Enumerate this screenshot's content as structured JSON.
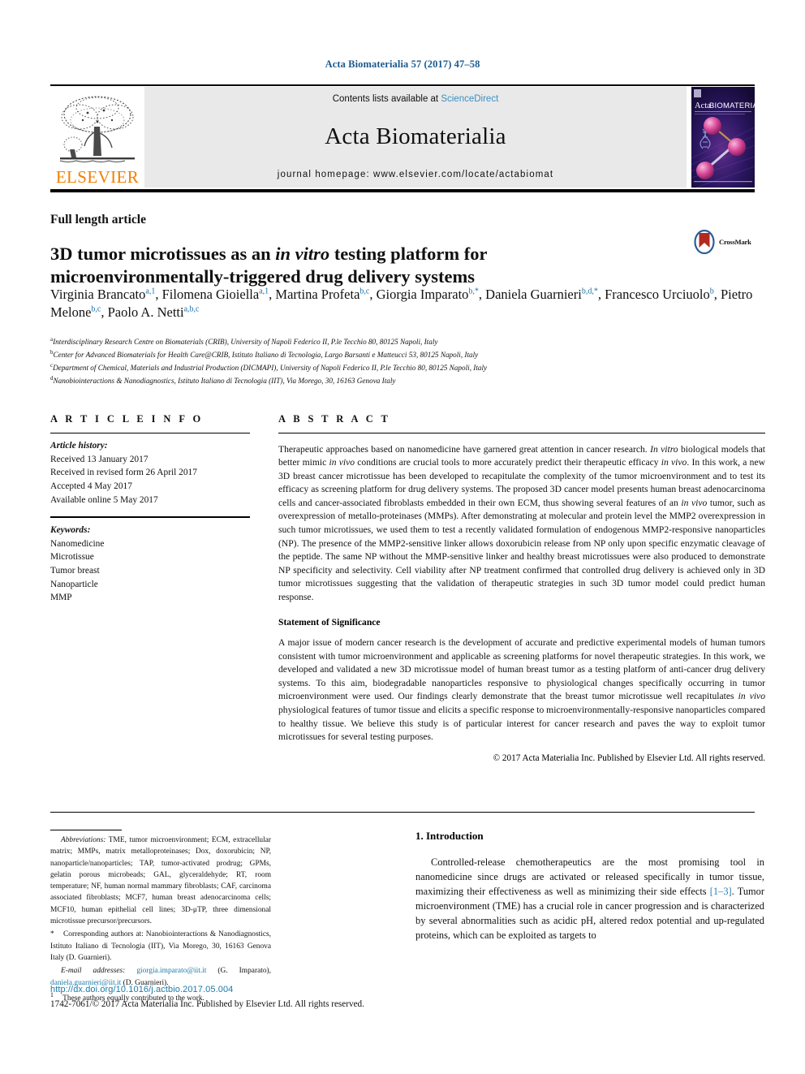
{
  "running_head": "Acta Biomaterialia 57 (2017) 47–58",
  "masthead": {
    "contents_prefix": "Contents lists available at ",
    "sciencedirect": "ScienceDirect",
    "journal_title": "Acta Biomaterialia",
    "homepage": "journal homepage: www.elsevier.com/locate/actabiomat",
    "publisher_word": "ELSEVIER",
    "cover_title": "Acta BIOMATERIALIA",
    "accent_orange": "#f08000",
    "link_blue": "#3a8fc4",
    "band_gray": "#e9e9e9"
  },
  "article": {
    "type": "Full length article",
    "title_line1": "3D tumor microtissues as an ",
    "title_italic": "in vitro",
    "title_line1b": " testing platform for",
    "title_line2": "microenvironmentally-triggered drug delivery systems",
    "crossmark_label": "CrossMark",
    "authors": [
      {
        "name": "Virginia Brancato",
        "sup": "a,1",
        "sep": ", "
      },
      {
        "name": "Filomena Gioiella",
        "sup": "a,1",
        "sep": ", "
      },
      {
        "name": "Martina Profeta",
        "sup": "b,c",
        "sep": ", "
      },
      {
        "name": "Giorgia Imparato",
        "sup": "b,*",
        "sep": ", "
      },
      {
        "name": "Daniela Guarnieri",
        "sup": "b,d,*",
        "sep": ", "
      },
      {
        "name": "Francesco Urciuolo",
        "sup": "b",
        "sep": ", "
      },
      {
        "name": "Pietro Melone",
        "sup": "b,c",
        "sep": ", "
      },
      {
        "name": "Paolo A. Netti",
        "sup": "a,b,c",
        "sep": ""
      }
    ],
    "affiliations": [
      {
        "key": "a",
        "text": "Interdisciplinary Research Centre on Biomaterials (CRIB), University of Napoli Federico II, P.le Tecchio 80, 80125 Napoli, Italy"
      },
      {
        "key": "b",
        "text": "Center for Advanced Biomaterials for Health Care@CRIB, Istituto Italiano di Tecnologia, Largo Barsanti e Matteucci 53, 80125 Napoli, Italy"
      },
      {
        "key": "c",
        "text": "Department of Chemical, Materials and Industrial Production (DICMAPI), University of Napoli Federico II, P.le Tecchio 80, 80125 Napoli, Italy"
      },
      {
        "key": "d",
        "text": "Nanobiointeractions & Nanodiagnostics, Istituto Italiano di Tecnologia (IIT), Via Morego, 30, 16163 Genova Italy"
      }
    ]
  },
  "article_info": {
    "heading": "A R T I C L E   I N F O",
    "history_label": "Article history:",
    "history": [
      "Received 13 January 2017",
      "Received in revised form 26 April 2017",
      "Accepted 4 May 2017",
      "Available online 5 May 2017"
    ],
    "keywords_label": "Keywords:",
    "keywords": [
      "Nanomedicine",
      "Microtissue",
      "Tumor breast",
      "Nanoparticle",
      "MMP"
    ]
  },
  "abstract": {
    "heading": "A B S T R A C T",
    "p1_a": "Therapeutic approaches based on nanomedicine have garnered great attention in cancer research. ",
    "p1_i1": "In vitro",
    "p1_b": " biological models that better mimic ",
    "p1_i2": "in vivo",
    "p1_c": " conditions are crucial tools to more accurately predict their therapeutic efficacy ",
    "p1_i3": "in vivo",
    "p1_d": ". In this work, a new 3D breast cancer microtissue has been developed to recapitulate the complexity of the tumor microenvironment and to test its efficacy as screening platform for drug delivery systems. The proposed 3D cancer model presents human breast adenocarcinoma cells and cancer-associated fibroblasts embedded in their own ECM, thus showing several features of an ",
    "p1_i4": "in vivo",
    "p1_e": " tumor, such as overexpression of metallo-proteinases (MMPs). After demonstrating at molecular and protein level the MMP2 overexpression in such tumor microtissues, we used them to test a recently validated formulation of endogenous MMP2-responsive nanoparticles (NP). The presence of the MMP2-sensitive linker allows doxorubicin release from NP only upon specific enzymatic cleavage of the peptide. The same NP without the MMP-sensitive linker and healthy breast microtissues were also produced to demonstrate NP specificity and selectivity. Cell viability after NP treatment confirmed that controlled drug delivery is achieved only in 3D tumor microtissues suggesting that the validation of therapeutic strategies in such 3D tumor model could predict human response.",
    "sos_heading": "Statement of Significance",
    "sos_a": "A major issue of modern cancer research is the development of accurate and predictive experimental models of human tumors consistent with tumor microenvironment and applicable as screening platforms for novel therapeutic strategies. In this work, we developed and validated a new 3D microtissue model of human breast tumor as a testing platform of anti-cancer drug delivery systems. To this aim, biodegradable nanoparticles responsive to physiological changes specifically occurring in tumor microenvironment were used. Our findings clearly demonstrate that the breast tumor microtissue well recapitulates ",
    "sos_i1": "in vivo",
    "sos_b": " physiological features of tumor tissue and elicits a specific response to microenvironmentally-responsive nanoparticles compared to healthy tissue. We believe this study is of particular interest for cancer research and paves the way to exploit tumor microtissues for several testing purposes.",
    "copyright": "© 2017 Acta Materialia Inc. Published by Elsevier Ltd. All rights reserved."
  },
  "footnotes": {
    "abbrev_label": "Abbreviations:",
    "abbrev_text": " TME, tumor microenvironment; ECM, extracellular matrix; MMPs, matrix metalloproteinases; Dox, doxorubicin; NP, nanoparticle/nanoparticles; TAP, tumor-activated prodrug; GPMs, gelatin porous microbeads; GAL, glyceraldehyde; RT, room temperature; NF, human normal mammary fibroblasts; CAF, carcinoma associated fibroblasts; MCF7, human breast adenocarcinoma cells; MCF10, human epithelial cell lines; 3D-μTP, three dimensional microtissue precursor/precursors.",
    "corresponding_marker": "*",
    "corresponding_text": " Corresponding authors at: Nanobiointeractions & Nanodiagnostics, Istituto Italiano di Tecnologia (IIT), Via Morego, 30, 16163 Genova Italy (D. Guarnieri).",
    "email_label": "E-mail addresses:",
    "email1": "giorgia.imparato@iit.it",
    "email1_owner": " (G. Imparato), ",
    "email2": "daniela.guarnieri@iit.it",
    "email2_owner": " (D. Guarnieri).",
    "equal_marker": "1",
    "equal_text": " These authors equally contributed to the work."
  },
  "introduction": {
    "heading": "1. Introduction",
    "p1_a": "Controlled-release chemotherapeutics are the most promising tool in nanomedicine since drugs are activated or released specifically in tumor tissue, maximizing their effectiveness as well as minimizing their side effects ",
    "p1_ref": "[1–3]",
    "p1_b": ". Tumor microenvironment (TME) has a crucial role in cancer progression and is characterized by several abnormalities such as acidic pH, altered redox potential and up-regulated proteins, which can be exploited as targets to"
  },
  "footer": {
    "doi": "http://dx.doi.org/10.1016/j.actbio.2017.05.004",
    "imprint": "1742-7061/© 2017 Acta Materialia Inc. Published by Elsevier Ltd. All rights reserved."
  }
}
